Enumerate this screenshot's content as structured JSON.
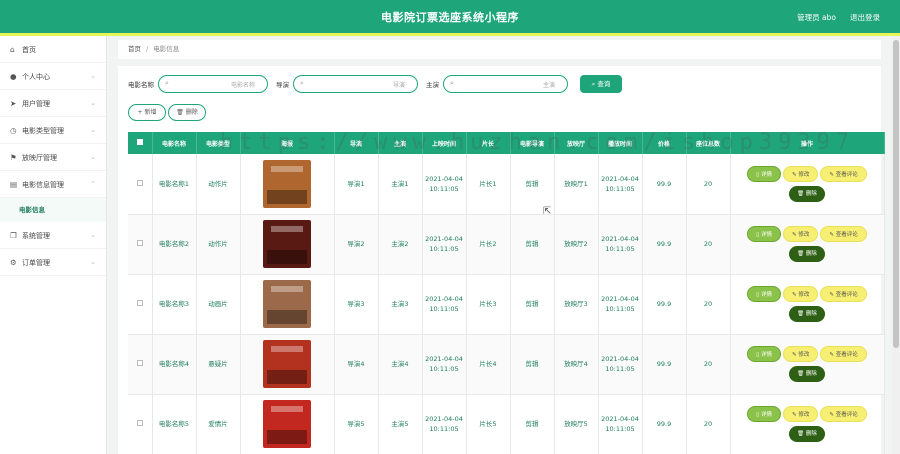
{
  "header": {
    "title": "电影院订票选座系统小程序",
    "user": "管理员 abo",
    "logout": "退出登录"
  },
  "sidebar": {
    "items": [
      {
        "label": "首页",
        "icon": "home-icon"
      },
      {
        "label": "个人中心",
        "icon": "user-icon"
      },
      {
        "label": "用户管理",
        "icon": "send-icon"
      },
      {
        "label": "电影类型管理",
        "icon": "clock-icon"
      },
      {
        "label": "放映厅管理",
        "icon": "flag-icon"
      },
      {
        "label": "电影信息管理",
        "icon": "list-icon"
      }
    ],
    "sub_item": "电影信息",
    "items_after": [
      {
        "label": "系统管理",
        "icon": "copy-icon"
      },
      {
        "label": "订单管理",
        "icon": "gear-icon"
      }
    ]
  },
  "breadcrumb": {
    "home": "首页",
    "sep": "/",
    "current": "电影信息"
  },
  "search": {
    "name_label": "电影名称",
    "name_placeholder": "电影名称",
    "director_label": "导演",
    "director_placeholder": "导演",
    "actor_label": "主演",
    "actor_placeholder": "主演",
    "search_button": "查询"
  },
  "actions": {
    "add": "+ 新增",
    "delete": "删除"
  },
  "table": {
    "headers": [
      "",
      "电影名称",
      "电影类型",
      "海报",
      "导演",
      "主演",
      "上映时间",
      "片长",
      "电影导演",
      "放映厅",
      "播放时间",
      "价格",
      "座位总数",
      "操作"
    ],
    "op_labels": {
      "detail": "详情",
      "edit": "修改",
      "review": "查看评论",
      "delete": "删除"
    },
    "rows": [
      {
        "name": "电影名称1",
        "type": "动作片",
        "director": "导演1",
        "actor": "主演1",
        "release": "2021-04-04 10:11:05",
        "length": "片长1",
        "dir2": "剪辑",
        "hall": "放映厅1",
        "play": "2021-04-04 10:11:05",
        "price": "99.9",
        "seats": "20",
        "poster_color": "#b0662f"
      },
      {
        "name": "电影名称2",
        "type": "动作片",
        "director": "导演2",
        "actor": "主演2",
        "release": "2021-04-04 10:11:05",
        "length": "片长2",
        "dir2": "剪辑",
        "hall": "放映厅2",
        "play": "2021-04-04 10:11:05",
        "price": "99.9",
        "seats": "20",
        "poster_color": "#5a1a14"
      },
      {
        "name": "电影名称3",
        "type": "动画片",
        "director": "导演3",
        "actor": "主演3",
        "release": "2021-04-04 10:11:05",
        "length": "片长3",
        "dir2": "剪辑",
        "hall": "放映厅3",
        "play": "2021-04-04 10:11:05",
        "price": "99.9",
        "seats": "20",
        "poster_color": "#9c6a4a"
      },
      {
        "name": "电影名称4",
        "type": "悬疑片",
        "director": "导演4",
        "actor": "主演4",
        "release": "2021-04-04 10:11:05",
        "length": "片长4",
        "dir2": "剪辑",
        "hall": "放映厅4",
        "play": "2021-04-04 10:11:05",
        "price": "99.9",
        "seats": "20",
        "poster_color": "#b3311f"
      },
      {
        "name": "电影名称5",
        "type": "爱情片",
        "director": "导演5",
        "actor": "主演5",
        "release": "2021-04-04 10:11:05",
        "length": "片长5",
        "dir2": "剪辑",
        "hall": "放映厅5",
        "play": "2021-04-04 10:11:05",
        "price": "99.9",
        "seats": "20",
        "poster_color": "#c2281f"
      }
    ]
  },
  "watermark": "https://www.huzhan.com/ishop39397",
  "colors": {
    "primary": "#1ea67a",
    "accent": "#e6f55a",
    "detail": "#8bc34a",
    "edit": "#f7ef72",
    "delete": "#2d6014"
  }
}
